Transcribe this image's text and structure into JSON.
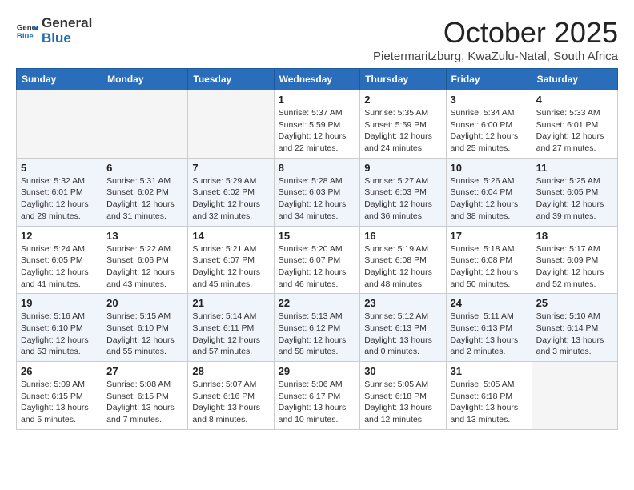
{
  "header": {
    "logo_general": "General",
    "logo_blue": "Blue",
    "month": "October 2025",
    "subtitle": "Pietermaritzburg, KwaZulu-Natal, South Africa"
  },
  "days_of_week": [
    "Sunday",
    "Monday",
    "Tuesday",
    "Wednesday",
    "Thursday",
    "Friday",
    "Saturday"
  ],
  "weeks": [
    [
      {
        "day": "",
        "info": ""
      },
      {
        "day": "",
        "info": ""
      },
      {
        "day": "",
        "info": ""
      },
      {
        "day": "1",
        "info": "Sunrise: 5:37 AM\nSunset: 5:59 PM\nDaylight: 12 hours\nand 22 minutes."
      },
      {
        "day": "2",
        "info": "Sunrise: 5:35 AM\nSunset: 5:59 PM\nDaylight: 12 hours\nand 24 minutes."
      },
      {
        "day": "3",
        "info": "Sunrise: 5:34 AM\nSunset: 6:00 PM\nDaylight: 12 hours\nand 25 minutes."
      },
      {
        "day": "4",
        "info": "Sunrise: 5:33 AM\nSunset: 6:01 PM\nDaylight: 12 hours\nand 27 minutes."
      }
    ],
    [
      {
        "day": "5",
        "info": "Sunrise: 5:32 AM\nSunset: 6:01 PM\nDaylight: 12 hours\nand 29 minutes."
      },
      {
        "day": "6",
        "info": "Sunrise: 5:31 AM\nSunset: 6:02 PM\nDaylight: 12 hours\nand 31 minutes."
      },
      {
        "day": "7",
        "info": "Sunrise: 5:29 AM\nSunset: 6:02 PM\nDaylight: 12 hours\nand 32 minutes."
      },
      {
        "day": "8",
        "info": "Sunrise: 5:28 AM\nSunset: 6:03 PM\nDaylight: 12 hours\nand 34 minutes."
      },
      {
        "day": "9",
        "info": "Sunrise: 5:27 AM\nSunset: 6:03 PM\nDaylight: 12 hours\nand 36 minutes."
      },
      {
        "day": "10",
        "info": "Sunrise: 5:26 AM\nSunset: 6:04 PM\nDaylight: 12 hours\nand 38 minutes."
      },
      {
        "day": "11",
        "info": "Sunrise: 5:25 AM\nSunset: 6:05 PM\nDaylight: 12 hours\nand 39 minutes."
      }
    ],
    [
      {
        "day": "12",
        "info": "Sunrise: 5:24 AM\nSunset: 6:05 PM\nDaylight: 12 hours\nand 41 minutes."
      },
      {
        "day": "13",
        "info": "Sunrise: 5:22 AM\nSunset: 6:06 PM\nDaylight: 12 hours\nand 43 minutes."
      },
      {
        "day": "14",
        "info": "Sunrise: 5:21 AM\nSunset: 6:07 PM\nDaylight: 12 hours\nand 45 minutes."
      },
      {
        "day": "15",
        "info": "Sunrise: 5:20 AM\nSunset: 6:07 PM\nDaylight: 12 hours\nand 46 minutes."
      },
      {
        "day": "16",
        "info": "Sunrise: 5:19 AM\nSunset: 6:08 PM\nDaylight: 12 hours\nand 48 minutes."
      },
      {
        "day": "17",
        "info": "Sunrise: 5:18 AM\nSunset: 6:08 PM\nDaylight: 12 hours\nand 50 minutes."
      },
      {
        "day": "18",
        "info": "Sunrise: 5:17 AM\nSunset: 6:09 PM\nDaylight: 12 hours\nand 52 minutes."
      }
    ],
    [
      {
        "day": "19",
        "info": "Sunrise: 5:16 AM\nSunset: 6:10 PM\nDaylight: 12 hours\nand 53 minutes."
      },
      {
        "day": "20",
        "info": "Sunrise: 5:15 AM\nSunset: 6:10 PM\nDaylight: 12 hours\nand 55 minutes."
      },
      {
        "day": "21",
        "info": "Sunrise: 5:14 AM\nSunset: 6:11 PM\nDaylight: 12 hours\nand 57 minutes."
      },
      {
        "day": "22",
        "info": "Sunrise: 5:13 AM\nSunset: 6:12 PM\nDaylight: 12 hours\nand 58 minutes."
      },
      {
        "day": "23",
        "info": "Sunrise: 5:12 AM\nSunset: 6:13 PM\nDaylight: 13 hours\nand 0 minutes."
      },
      {
        "day": "24",
        "info": "Sunrise: 5:11 AM\nSunset: 6:13 PM\nDaylight: 13 hours\nand 2 minutes."
      },
      {
        "day": "25",
        "info": "Sunrise: 5:10 AM\nSunset: 6:14 PM\nDaylight: 13 hours\nand 3 minutes."
      }
    ],
    [
      {
        "day": "26",
        "info": "Sunrise: 5:09 AM\nSunset: 6:15 PM\nDaylight: 13 hours\nand 5 minutes."
      },
      {
        "day": "27",
        "info": "Sunrise: 5:08 AM\nSunset: 6:15 PM\nDaylight: 13 hours\nand 7 minutes."
      },
      {
        "day": "28",
        "info": "Sunrise: 5:07 AM\nSunset: 6:16 PM\nDaylight: 13 hours\nand 8 minutes."
      },
      {
        "day": "29",
        "info": "Sunrise: 5:06 AM\nSunset: 6:17 PM\nDaylight: 13 hours\nand 10 minutes."
      },
      {
        "day": "30",
        "info": "Sunrise: 5:05 AM\nSunset: 6:18 PM\nDaylight: 13 hours\nand 12 minutes."
      },
      {
        "day": "31",
        "info": "Sunrise: 5:05 AM\nSunset: 6:18 PM\nDaylight: 13 hours\nand 13 minutes."
      },
      {
        "day": "",
        "info": ""
      }
    ]
  ]
}
